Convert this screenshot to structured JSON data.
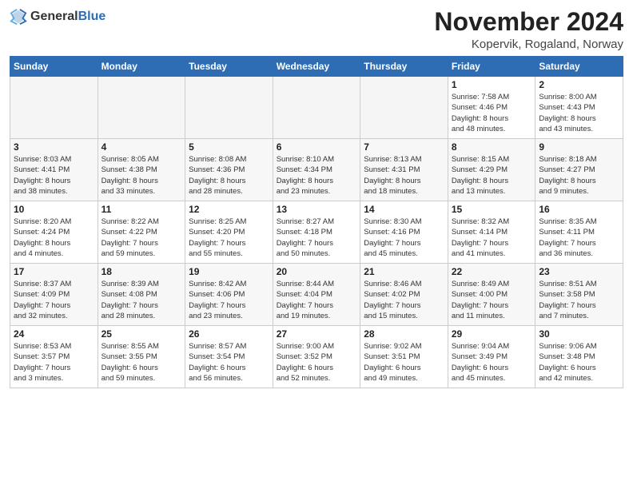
{
  "header": {
    "logo_general": "General",
    "logo_blue": "Blue",
    "month_title": "November 2024",
    "location": "Kopervik, Rogaland, Norway"
  },
  "weekdays": [
    "Sunday",
    "Monday",
    "Tuesday",
    "Wednesday",
    "Thursday",
    "Friday",
    "Saturday"
  ],
  "weeks": [
    [
      {
        "day": "",
        "info": ""
      },
      {
        "day": "",
        "info": ""
      },
      {
        "day": "",
        "info": ""
      },
      {
        "day": "",
        "info": ""
      },
      {
        "day": "",
        "info": ""
      },
      {
        "day": "1",
        "info": "Sunrise: 7:58 AM\nSunset: 4:46 PM\nDaylight: 8 hours\nand 48 minutes."
      },
      {
        "day": "2",
        "info": "Sunrise: 8:00 AM\nSunset: 4:43 PM\nDaylight: 8 hours\nand 43 minutes."
      }
    ],
    [
      {
        "day": "3",
        "info": "Sunrise: 8:03 AM\nSunset: 4:41 PM\nDaylight: 8 hours\nand 38 minutes."
      },
      {
        "day": "4",
        "info": "Sunrise: 8:05 AM\nSunset: 4:38 PM\nDaylight: 8 hours\nand 33 minutes."
      },
      {
        "day": "5",
        "info": "Sunrise: 8:08 AM\nSunset: 4:36 PM\nDaylight: 8 hours\nand 28 minutes."
      },
      {
        "day": "6",
        "info": "Sunrise: 8:10 AM\nSunset: 4:34 PM\nDaylight: 8 hours\nand 23 minutes."
      },
      {
        "day": "7",
        "info": "Sunrise: 8:13 AM\nSunset: 4:31 PM\nDaylight: 8 hours\nand 18 minutes."
      },
      {
        "day": "8",
        "info": "Sunrise: 8:15 AM\nSunset: 4:29 PM\nDaylight: 8 hours\nand 13 minutes."
      },
      {
        "day": "9",
        "info": "Sunrise: 8:18 AM\nSunset: 4:27 PM\nDaylight: 8 hours\nand 9 minutes."
      }
    ],
    [
      {
        "day": "10",
        "info": "Sunrise: 8:20 AM\nSunset: 4:24 PM\nDaylight: 8 hours\nand 4 minutes."
      },
      {
        "day": "11",
        "info": "Sunrise: 8:22 AM\nSunset: 4:22 PM\nDaylight: 7 hours\nand 59 minutes."
      },
      {
        "day": "12",
        "info": "Sunrise: 8:25 AM\nSunset: 4:20 PM\nDaylight: 7 hours\nand 55 minutes."
      },
      {
        "day": "13",
        "info": "Sunrise: 8:27 AM\nSunset: 4:18 PM\nDaylight: 7 hours\nand 50 minutes."
      },
      {
        "day": "14",
        "info": "Sunrise: 8:30 AM\nSunset: 4:16 PM\nDaylight: 7 hours\nand 45 minutes."
      },
      {
        "day": "15",
        "info": "Sunrise: 8:32 AM\nSunset: 4:14 PM\nDaylight: 7 hours\nand 41 minutes."
      },
      {
        "day": "16",
        "info": "Sunrise: 8:35 AM\nSunset: 4:11 PM\nDaylight: 7 hours\nand 36 minutes."
      }
    ],
    [
      {
        "day": "17",
        "info": "Sunrise: 8:37 AM\nSunset: 4:09 PM\nDaylight: 7 hours\nand 32 minutes."
      },
      {
        "day": "18",
        "info": "Sunrise: 8:39 AM\nSunset: 4:08 PM\nDaylight: 7 hours\nand 28 minutes."
      },
      {
        "day": "19",
        "info": "Sunrise: 8:42 AM\nSunset: 4:06 PM\nDaylight: 7 hours\nand 23 minutes."
      },
      {
        "day": "20",
        "info": "Sunrise: 8:44 AM\nSunset: 4:04 PM\nDaylight: 7 hours\nand 19 minutes."
      },
      {
        "day": "21",
        "info": "Sunrise: 8:46 AM\nSunset: 4:02 PM\nDaylight: 7 hours\nand 15 minutes."
      },
      {
        "day": "22",
        "info": "Sunrise: 8:49 AM\nSunset: 4:00 PM\nDaylight: 7 hours\nand 11 minutes."
      },
      {
        "day": "23",
        "info": "Sunrise: 8:51 AM\nSunset: 3:58 PM\nDaylight: 7 hours\nand 7 minutes."
      }
    ],
    [
      {
        "day": "24",
        "info": "Sunrise: 8:53 AM\nSunset: 3:57 PM\nDaylight: 7 hours\nand 3 minutes."
      },
      {
        "day": "25",
        "info": "Sunrise: 8:55 AM\nSunset: 3:55 PM\nDaylight: 6 hours\nand 59 minutes."
      },
      {
        "day": "26",
        "info": "Sunrise: 8:57 AM\nSunset: 3:54 PM\nDaylight: 6 hours\nand 56 minutes."
      },
      {
        "day": "27",
        "info": "Sunrise: 9:00 AM\nSunset: 3:52 PM\nDaylight: 6 hours\nand 52 minutes."
      },
      {
        "day": "28",
        "info": "Sunrise: 9:02 AM\nSunset: 3:51 PM\nDaylight: 6 hours\nand 49 minutes."
      },
      {
        "day": "29",
        "info": "Sunrise: 9:04 AM\nSunset: 3:49 PM\nDaylight: 6 hours\nand 45 minutes."
      },
      {
        "day": "30",
        "info": "Sunrise: 9:06 AM\nSunset: 3:48 PM\nDaylight: 6 hours\nand 42 minutes."
      }
    ]
  ]
}
